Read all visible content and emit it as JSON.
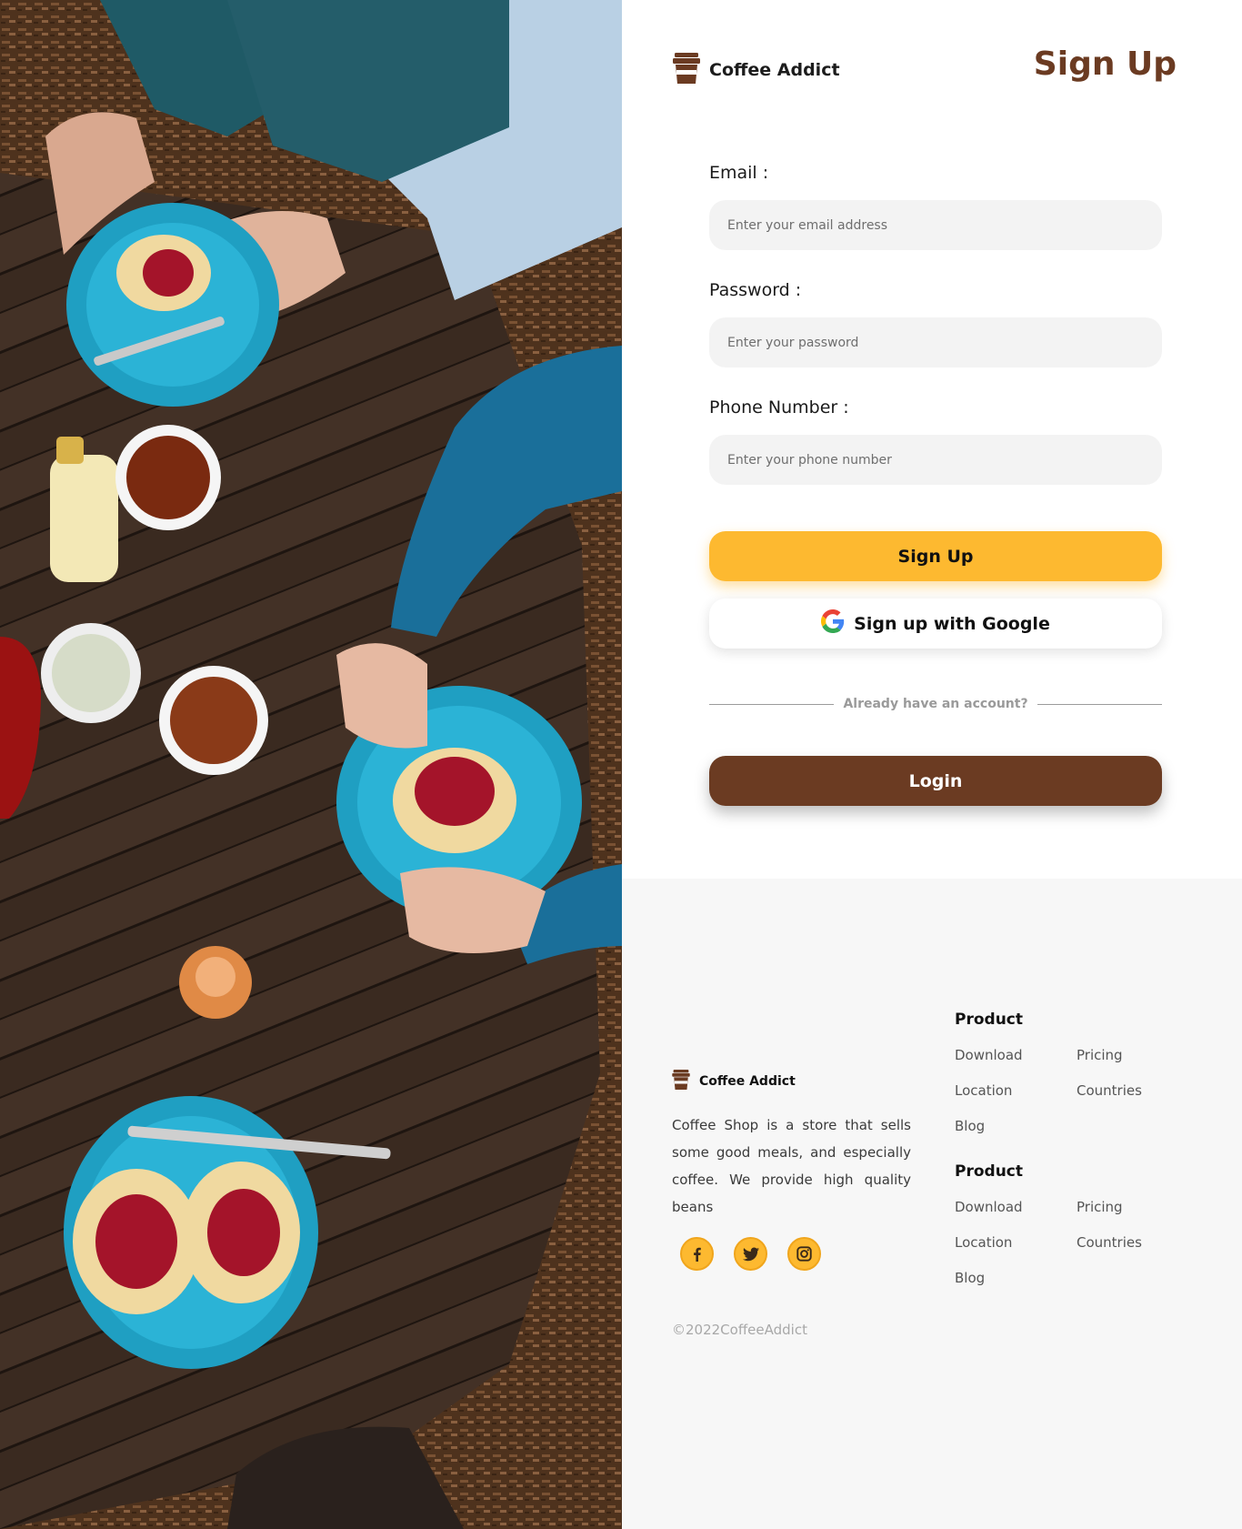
{
  "brand": {
    "name": "Coffee Addict",
    "icon": "coffee-cup-icon"
  },
  "page": {
    "title": "Sign Up"
  },
  "form": {
    "email": {
      "label": "Email :",
      "placeholder": "Enter your email address",
      "value": ""
    },
    "password": {
      "label": "Password :",
      "placeholder": "Enter your password",
      "value": ""
    },
    "phone": {
      "label": "Phone Number :",
      "placeholder": "Enter your phone number",
      "value": ""
    }
  },
  "actions": {
    "signup_label": "Sign Up",
    "google_label": "Sign up with Google",
    "divider_text": "Already have an account?",
    "login_label": "Login"
  },
  "footer": {
    "brand_name": "Coffee Addict",
    "description": "Coffee Shop is a store that sells some good meals, and especially coffee. We provide high quality beans",
    "socials": [
      "facebook-icon",
      "twitter-icon",
      "instagram-icon"
    ],
    "link_groups": [
      {
        "title": "Product",
        "links": [
          "Download",
          "Pricing",
          "Location",
          "Countries",
          "Blog"
        ]
      },
      {
        "title": "Product",
        "links": [
          "Download",
          "Pricing",
          "Location",
          "Countries",
          "Blog"
        ]
      }
    ],
    "copyright": "©2022CoffeeAddict"
  },
  "colors": {
    "accent": "#fdb930",
    "brand_brown": "#6b3b22",
    "input_bg": "#f3f3f3",
    "footer_bg": "#f7f7f7"
  }
}
